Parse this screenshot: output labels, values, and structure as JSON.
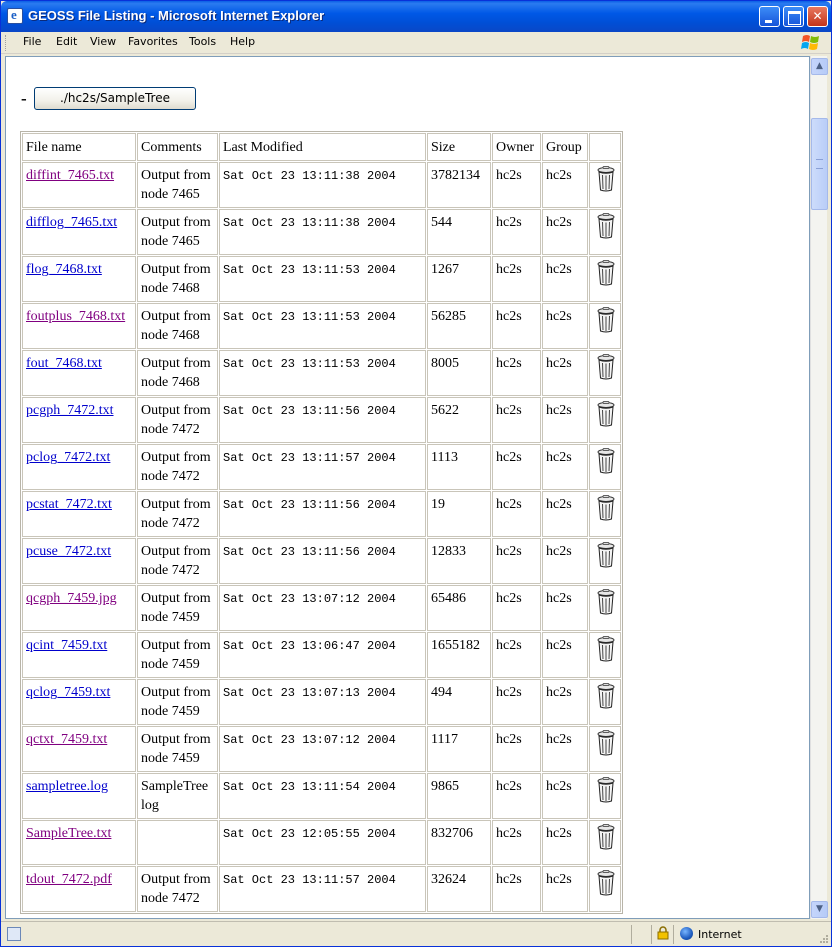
{
  "window": {
    "title": "GEOSS File Listing - Microsoft Internet Explorer"
  },
  "menu": [
    "File",
    "Edit",
    "View",
    "Favorites",
    "Tools",
    "Help"
  ],
  "page": {
    "dash": "-",
    "path_button": "./hc2s/SampleTree"
  },
  "table": {
    "headers": [
      "File name",
      "Comments",
      "Last Modified",
      "Size",
      "Owner",
      "Group"
    ],
    "rows": [
      {
        "file": "diffint_7465.txt",
        "visited": true,
        "comment": "Output from node 7465",
        "modified": "Sat Oct 23 13:11:38 2004",
        "size": "3782134",
        "owner": "hc2s",
        "group": "hc2s"
      },
      {
        "file": "difflog_7465.txt",
        "visited": false,
        "comment": "Output from node 7465",
        "modified": "Sat Oct 23 13:11:38 2004",
        "size": "544",
        "owner": "hc2s",
        "group": "hc2s"
      },
      {
        "file": "flog_7468.txt",
        "visited": false,
        "comment": "Output from node 7468",
        "modified": "Sat Oct 23 13:11:53 2004",
        "size": "1267",
        "owner": "hc2s",
        "group": "hc2s"
      },
      {
        "file": "foutplus_7468.txt",
        "visited": true,
        "comment": "Output from node 7468",
        "modified": "Sat Oct 23 13:11:53 2004",
        "size": "56285",
        "owner": "hc2s",
        "group": "hc2s"
      },
      {
        "file": "fout_7468.txt",
        "visited": false,
        "comment": "Output from node 7468",
        "modified": "Sat Oct 23 13:11:53 2004",
        "size": "8005",
        "owner": "hc2s",
        "group": "hc2s"
      },
      {
        "file": "pcgph_7472.txt",
        "visited": false,
        "comment": "Output from node 7472",
        "modified": "Sat Oct 23 13:11:56 2004",
        "size": "5622",
        "owner": "hc2s",
        "group": "hc2s"
      },
      {
        "file": "pclog_7472.txt",
        "visited": false,
        "comment": "Output from node 7472",
        "modified": "Sat Oct 23 13:11:57 2004",
        "size": "1113",
        "owner": "hc2s",
        "group": "hc2s"
      },
      {
        "file": "pcstat_7472.txt",
        "visited": false,
        "comment": "Output from node 7472",
        "modified": "Sat Oct 23 13:11:56 2004",
        "size": "19",
        "owner": "hc2s",
        "group": "hc2s"
      },
      {
        "file": "pcuse_7472.txt",
        "visited": false,
        "comment": "Output from node 7472",
        "modified": "Sat Oct 23 13:11:56 2004",
        "size": "12833",
        "owner": "hc2s",
        "group": "hc2s"
      },
      {
        "file": "qcgph_7459.jpg",
        "visited": true,
        "comment": "Output from node 7459",
        "modified": "Sat Oct 23 13:07:12 2004",
        "size": "65486",
        "owner": "hc2s",
        "group": "hc2s"
      },
      {
        "file": "qcint_7459.txt",
        "visited": false,
        "comment": "Output from node 7459",
        "modified": "Sat Oct 23 13:06:47 2004",
        "size": "1655182",
        "owner": "hc2s",
        "group": "hc2s"
      },
      {
        "file": "qclog_7459.txt",
        "visited": false,
        "comment": "Output from node 7459",
        "modified": "Sat Oct 23 13:07:13 2004",
        "size": "494",
        "owner": "hc2s",
        "group": "hc2s"
      },
      {
        "file": "qctxt_7459.txt",
        "visited": true,
        "comment": "Output from node 7459",
        "modified": "Sat Oct 23 13:07:12 2004",
        "size": "1117",
        "owner": "hc2s",
        "group": "hc2s"
      },
      {
        "file": "sampletree.log",
        "visited": false,
        "comment": "SampleTree log",
        "modified": "Sat Oct 23 13:11:54 2004",
        "size": "9865",
        "owner": "hc2s",
        "group": "hc2s"
      },
      {
        "file": "SampleTree.txt",
        "visited": true,
        "comment": "",
        "modified": "Sat Oct 23 12:05:55 2004",
        "size": "832706",
        "owner": "hc2s",
        "group": "hc2s"
      },
      {
        "file": "tdout_7472.pdf",
        "visited": true,
        "comment": "Output from node 7472",
        "modified": "Sat Oct 23 13:11:57 2004",
        "size": "32624",
        "owner": "hc2s",
        "group": "hc2s"
      }
    ]
  },
  "status": {
    "zone": "Internet"
  },
  "icons": {
    "title": "ie-page-icon",
    "delete": "trash-icon",
    "lock": "lock-icon",
    "zone": "globe-icon"
  },
  "colors": {
    "link": "#0000cc",
    "visited_link": "#800080",
    "titlebar": "#0058e6"
  }
}
